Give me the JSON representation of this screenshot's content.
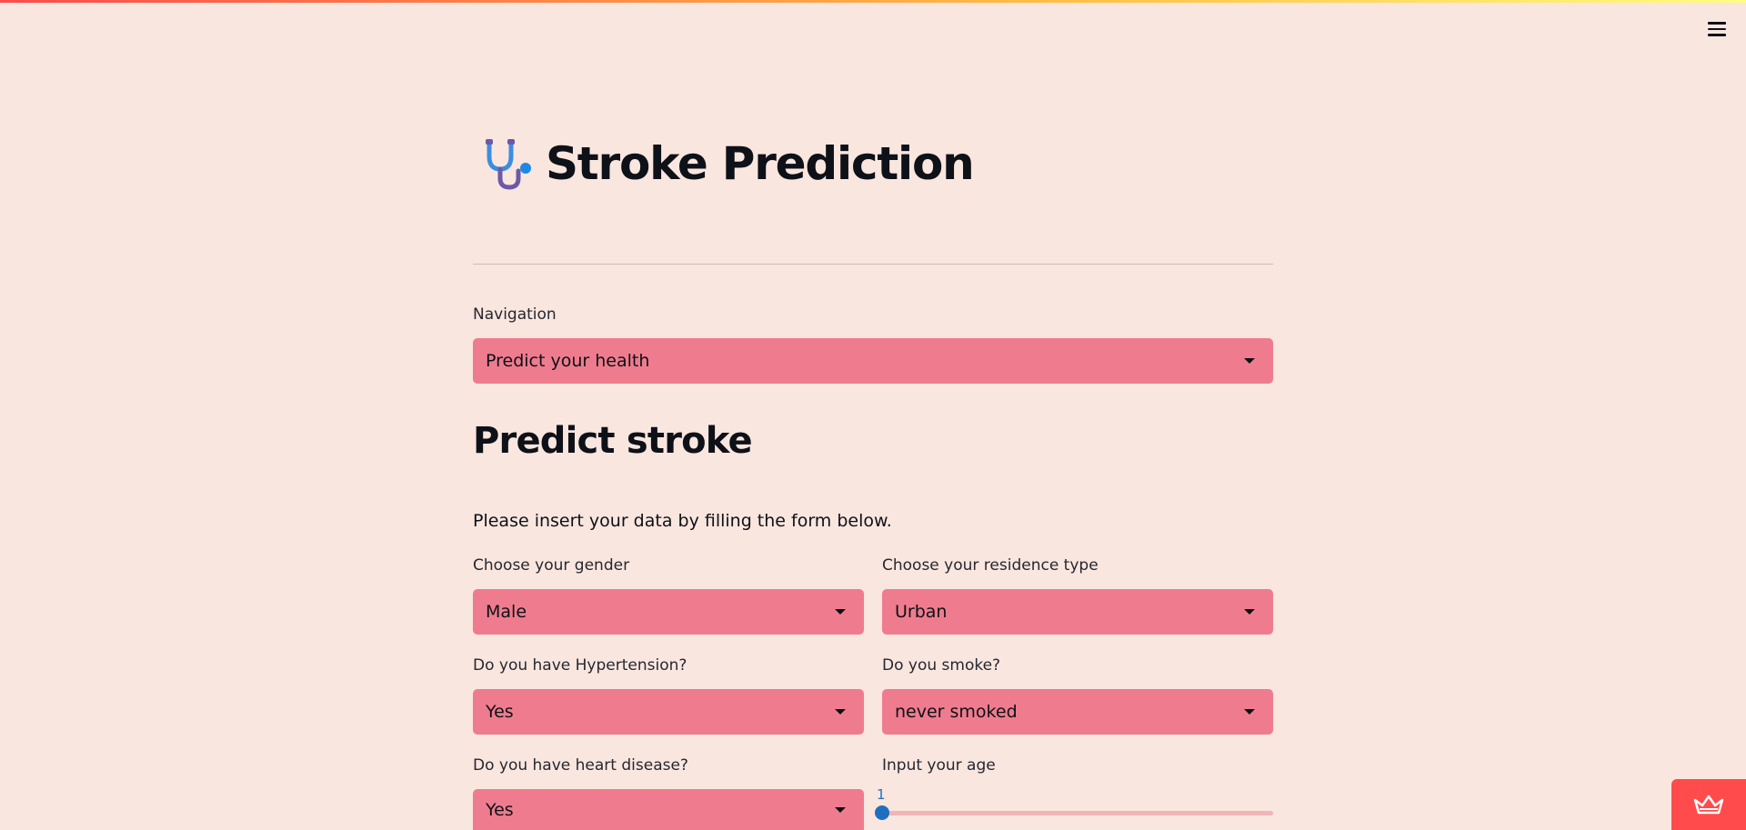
{
  "app": {
    "title": "Stroke Prediction",
    "logo_icon": "stethoscope-icon",
    "menu_icon": "hamburger-menu-icon",
    "badge_icon": "crown-icon"
  },
  "navigation": {
    "label": "Navigation",
    "selected": "Predict your health"
  },
  "section": {
    "title": "Predict stroke",
    "intro": "Please insert your data by filling the form below."
  },
  "form": {
    "gender": {
      "label": "Choose your gender",
      "selected": "Male"
    },
    "residence": {
      "label": "Choose your residence type",
      "selected": "Urban"
    },
    "hypertension": {
      "label": "Do you have Hypertension?",
      "selected": "Yes"
    },
    "smoke": {
      "label": "Do you smoke?",
      "selected": "never smoked"
    },
    "heart": {
      "label": "Do you have heart disease?",
      "selected": "Yes"
    },
    "age": {
      "label": "Input your age",
      "value": "1",
      "fraction": 0.0
    }
  },
  "colors": {
    "background": "#f9e6df",
    "select_fill": "#ef7c8e",
    "accent": "#ff4b4b",
    "slider": "#1f6fbf"
  }
}
